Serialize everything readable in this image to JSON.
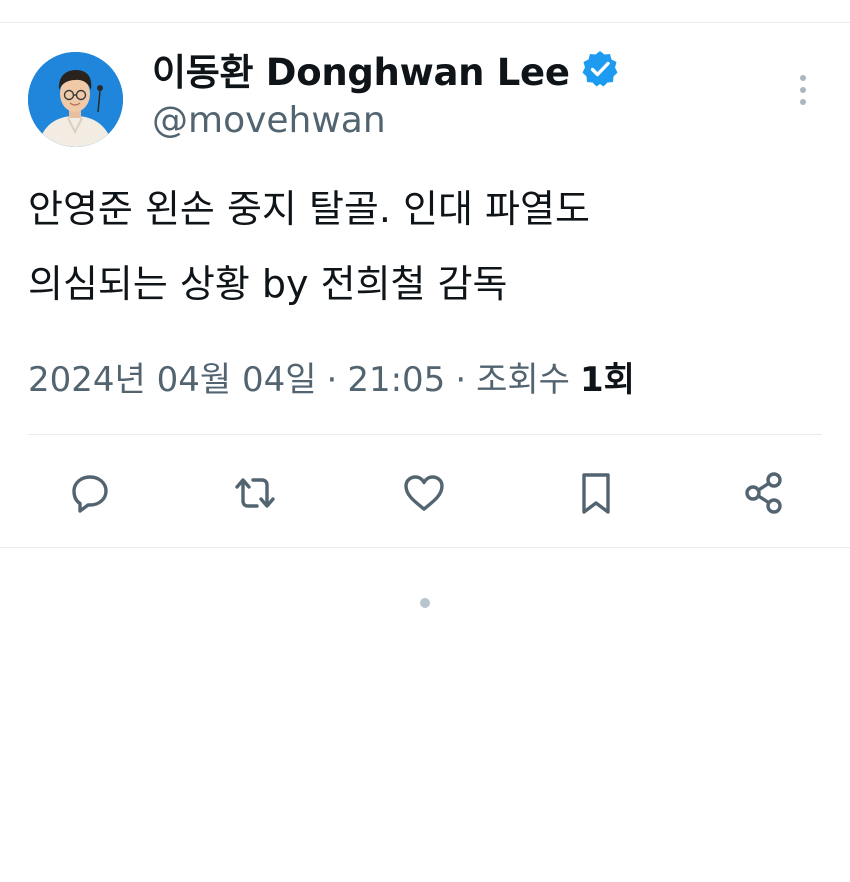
{
  "user": {
    "display_name": "이동환 Donghwan Lee",
    "handle": "@movehwan",
    "verified": true,
    "avatar_icon": "profile-photo"
  },
  "tweet": {
    "lines": [
      "안영준 왼손 중지 탈골. 인대 파열도",
      "의심되는 상황 by 전희철 감독"
    ]
  },
  "meta": {
    "date": "2024년 04월 04일",
    "separator": "·",
    "time": "21:05",
    "views_label": "조회수",
    "views_count": "1",
    "views_suffix": "회"
  },
  "actions": [
    {
      "name": "reply",
      "icon": "reply-icon"
    },
    {
      "name": "retweet",
      "icon": "retweet-icon"
    },
    {
      "name": "like",
      "icon": "heart-icon"
    },
    {
      "name": "bookmark",
      "icon": "bookmark-icon"
    },
    {
      "name": "share",
      "icon": "share-icon"
    }
  ],
  "colors": {
    "text_primary": "#0f1419",
    "text_secondary": "#536471",
    "verified_blue": "#1d9bf0",
    "divider": "#e7ecf0"
  }
}
